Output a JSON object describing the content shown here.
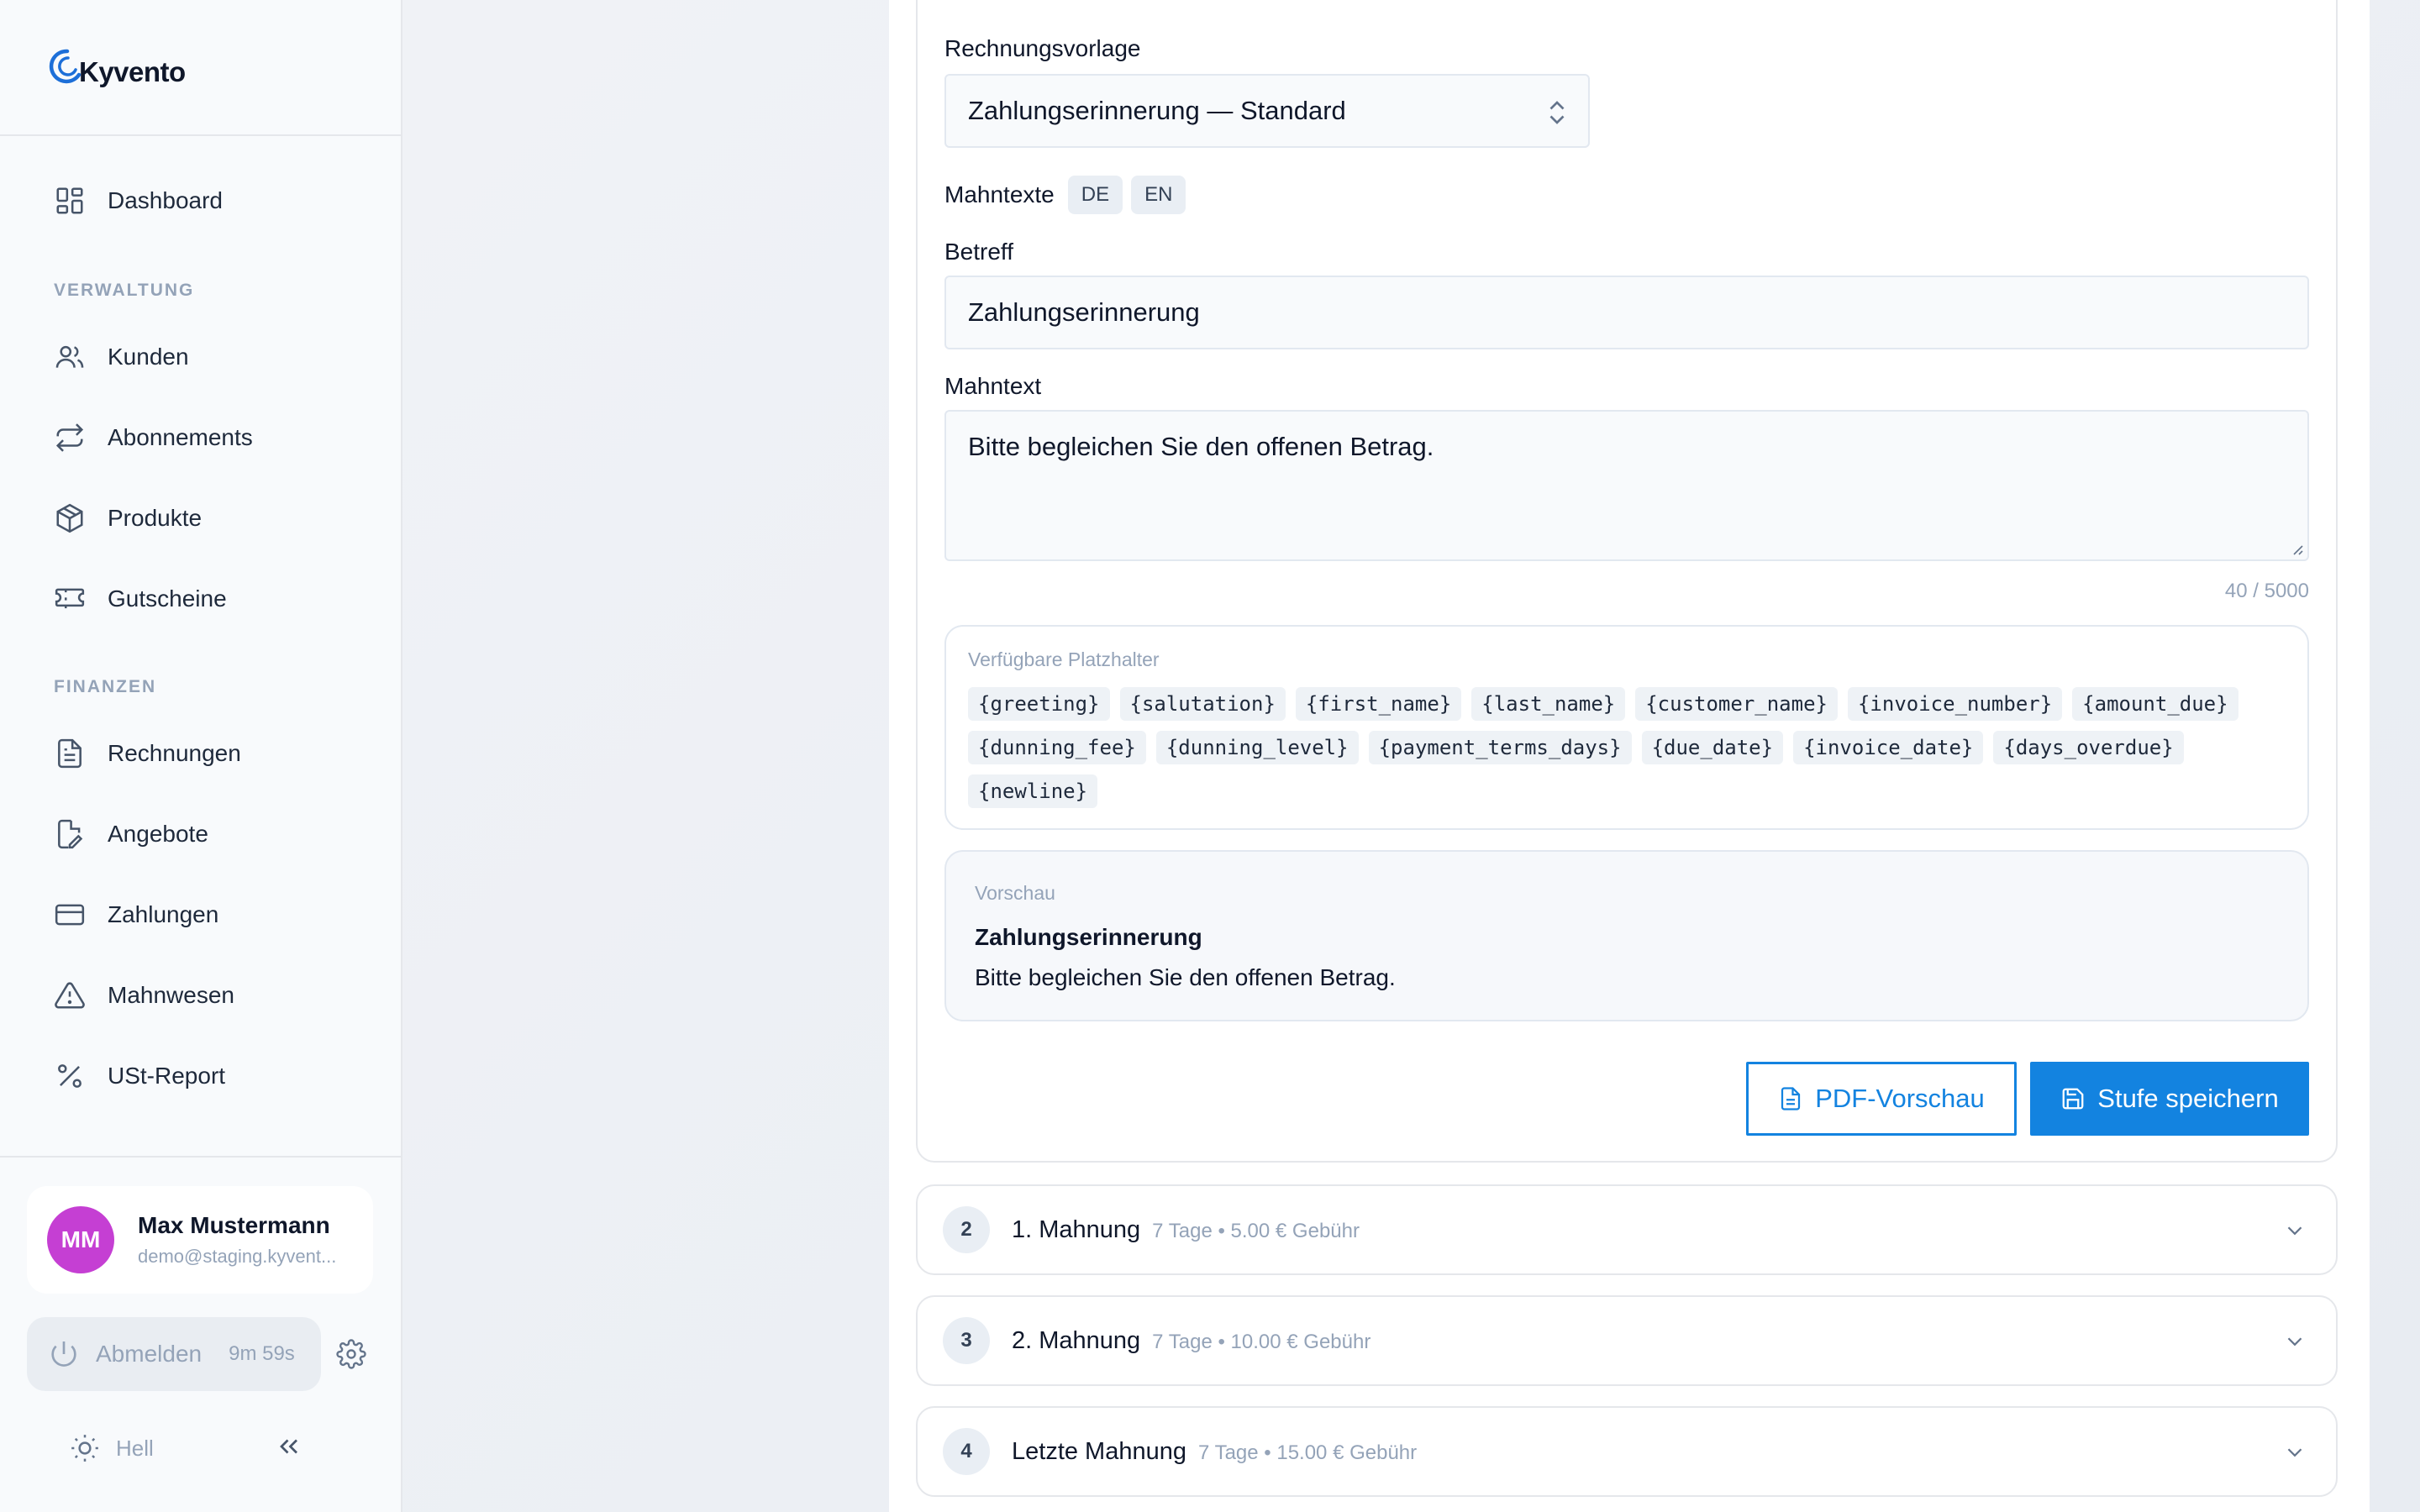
{
  "brand": {
    "name": "Kyvento"
  },
  "nav": {
    "dashboard": "Dashboard",
    "section_verwaltung": "VERWALTUNG",
    "kunden": "Kunden",
    "abonnements": "Abonnements",
    "produkte": "Produkte",
    "gutscheine": "Gutscheine",
    "section_finanzen": "FINANZEN",
    "rechnungen": "Rechnungen",
    "angebote": "Angebote",
    "zahlungen": "Zahlungen",
    "mahnwesen": "Mahnwesen",
    "ust_report": "USt-Report"
  },
  "user": {
    "initials": "MM",
    "name": "Max Mustermann",
    "email": "demo@staging.kyvent...",
    "avatar_color": "#c53fd3"
  },
  "session": {
    "logout_label": "Abmelden",
    "timer": "9m 59s"
  },
  "theme": {
    "label": "Hell"
  },
  "form": {
    "template_label": "Rechnungsvorlage",
    "template_value": "Zahlungserinnerung — Standard",
    "texts_label": "Mahntexte",
    "languages": [
      "DE",
      "EN"
    ],
    "subject_label": "Betreff",
    "subject_value": "Zahlungserinnerung",
    "body_label": "Mahntext",
    "body_value": "Bitte begleichen Sie den offenen Betrag.",
    "char_count": "40 / 5000"
  },
  "placeholders": {
    "title": "Verfügbare Platzhalter",
    "row1": [
      "{greeting}",
      "{salutation}",
      "{first_name}",
      "{last_name}",
      "{customer_name}",
      "{invoice_number}",
      "{amount_due}"
    ],
    "row2": [
      "{dunning_fee}",
      "{dunning_level}",
      "{payment_terms_days}",
      "{due_date}",
      "{invoice_date}",
      "{days_overdue}"
    ],
    "row3": [
      "{newline}"
    ]
  },
  "preview": {
    "label": "Vorschau",
    "subject": "Zahlungserinnerung",
    "body": "Bitte begleichen Sie den offenen Betrag."
  },
  "actions": {
    "pdf_preview": "PDF-Vorschau",
    "save_step": "Stufe speichern"
  },
  "steps": [
    {
      "number": "2",
      "title": "1. Mahnung",
      "meta": "7 Tage • 5.00 € Gebühr"
    },
    {
      "number": "3",
      "title": "2. Mahnung",
      "meta": "7 Tage • 10.00 € Gebühr"
    },
    {
      "number": "4",
      "title": "Letzte Mahnung",
      "meta": "7 Tage • 15.00 € Gebühr"
    }
  ],
  "colors": {
    "accent": "#1383e0",
    "brand_blue": "#1d6fd8"
  }
}
